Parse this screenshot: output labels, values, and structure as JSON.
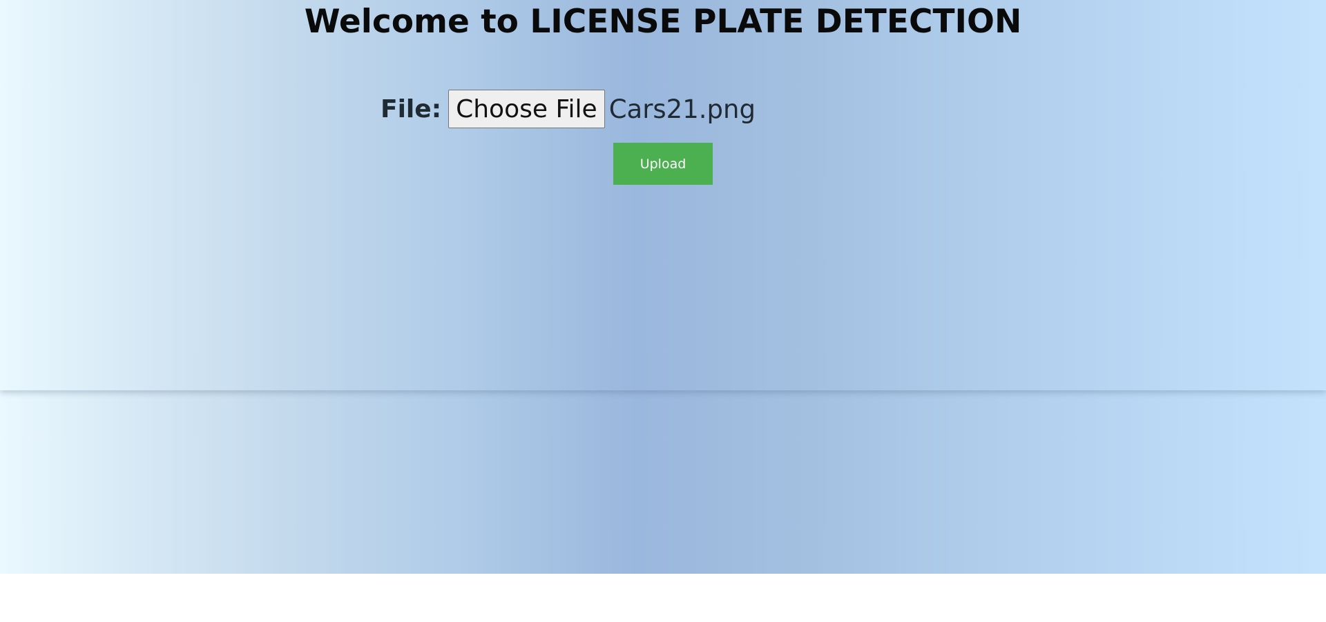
{
  "header": {
    "title": "Welcome to LICENSE PLATE DETECTION"
  },
  "upload_form": {
    "file_label": "File:",
    "choose_file_label": "Choose File",
    "selected_file_name": "Cars21.png",
    "upload_label": "Upload"
  },
  "colors": {
    "upload_button": "#4caf50",
    "gradient_left": "#eaf8ff",
    "gradient_mid": "#9ab7dd",
    "gradient_right": "#c4e2fc"
  }
}
